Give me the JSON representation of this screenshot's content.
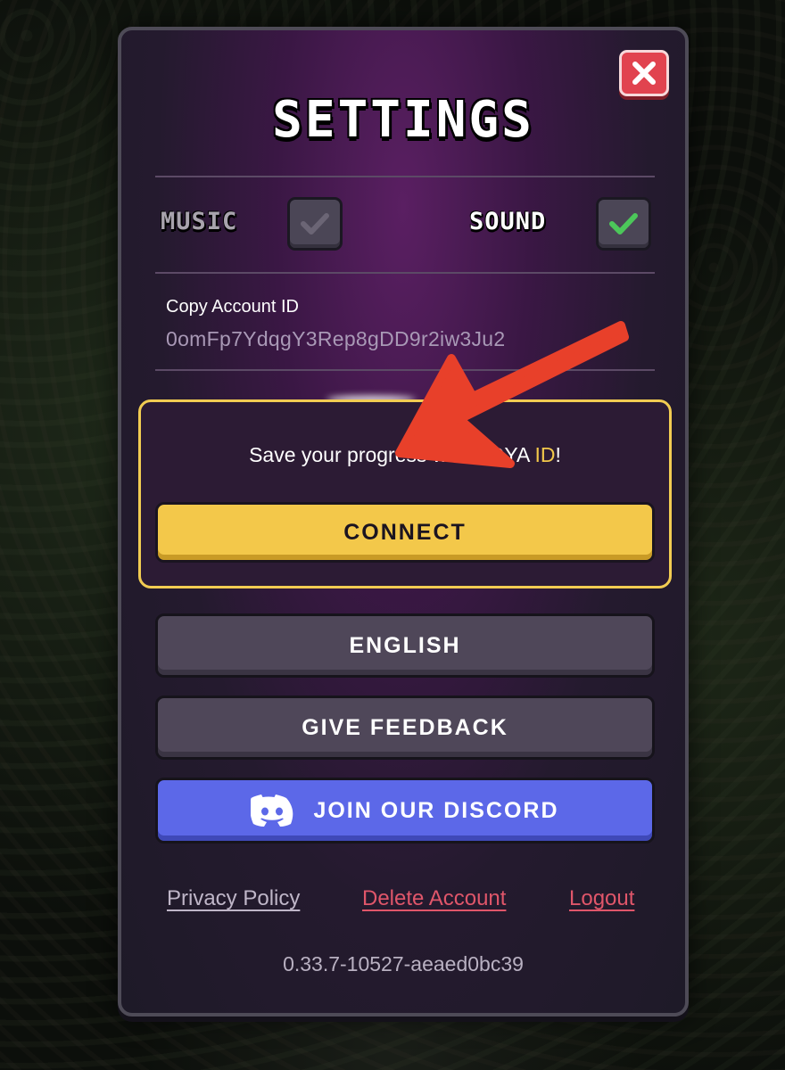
{
  "window": {
    "title": "SETTINGS",
    "close_icon": "close-icon"
  },
  "toggles": {
    "music": {
      "label": "MUSIC",
      "checked": false
    },
    "sound": {
      "label": "SOUND",
      "checked": true
    }
  },
  "account": {
    "label": "Copy Account ID",
    "id": "0omFp7YdqgY3Rep8gDD9r2iw3Ju2"
  },
  "save_prompt": {
    "text_prefix": "Save your progress with VOYA ",
    "text_accent": "ID",
    "text_suffix": "!",
    "connect_label": "CONNECT"
  },
  "buttons": {
    "language": "ENGLISH",
    "feedback": "GIVE FEEDBACK",
    "discord": "JOIN OUR DISCORD",
    "discord_icon": "discord-icon"
  },
  "links": {
    "privacy": "Privacy Policy",
    "delete": "Delete Account",
    "logout": "Logout"
  },
  "version": "0.33.7-10527-aeaed0bc39",
  "annotation": {
    "arrow_icon": "red-arrow-icon"
  },
  "colors": {
    "accent_yellow": "#f3c84a",
    "discord_blue": "#5c68e8",
    "danger_red": "#e0566a",
    "close_red": "#e1434f",
    "check_green": "#4cc75a"
  }
}
